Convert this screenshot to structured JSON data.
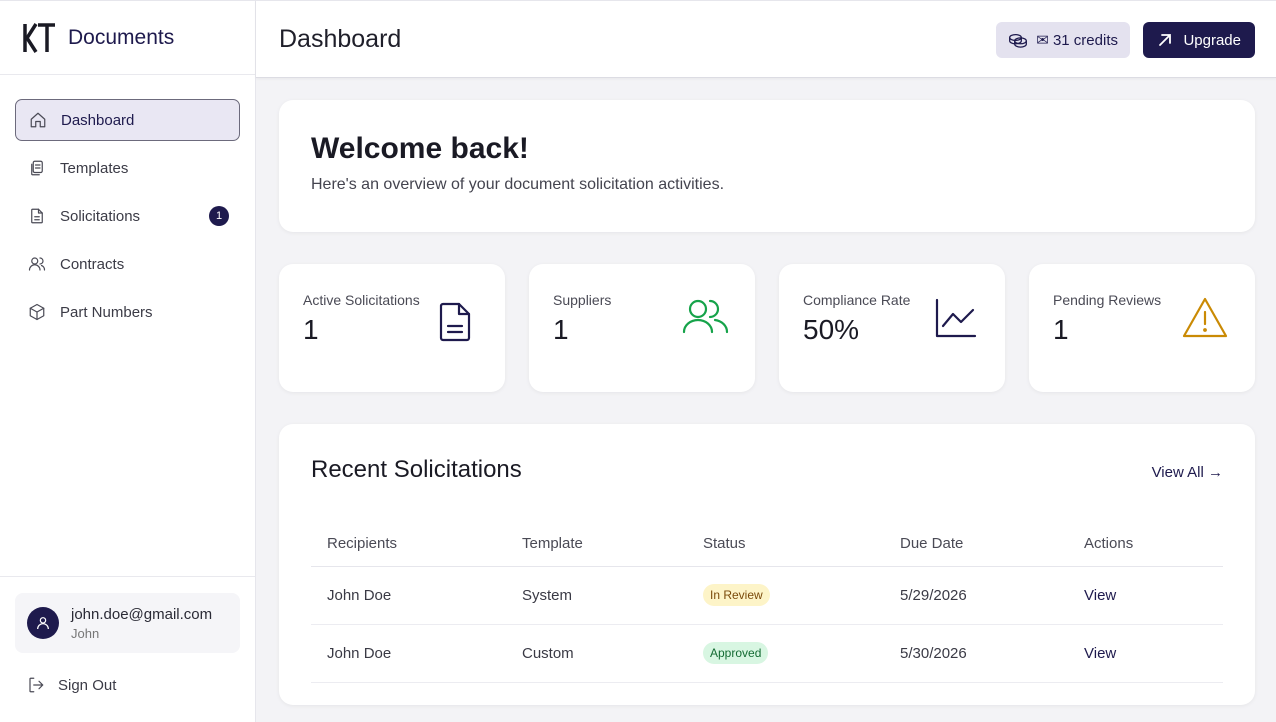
{
  "app": {
    "name": "Documents"
  },
  "sidebar": {
    "items": [
      {
        "label": "Dashboard",
        "icon": "home-icon",
        "active": true
      },
      {
        "label": "Templates",
        "icon": "copy-document-icon"
      },
      {
        "label": "Solicitations",
        "icon": "file-text-icon",
        "badge": "1"
      },
      {
        "label": "Contracts",
        "icon": "users-icon"
      },
      {
        "label": "Part Numbers",
        "icon": "box-icon"
      }
    ],
    "user": {
      "email": "john.doe@gmail.com",
      "name": "John"
    },
    "signout_label": "Sign Out"
  },
  "header": {
    "title": "Dashboard",
    "credits_label": "✉ 31 credits",
    "upgrade_label": "Upgrade"
  },
  "welcome": {
    "title": "Welcome back!",
    "subtitle": "Here's an overview of your document solicitation activities."
  },
  "stats": [
    {
      "label": "Active Solicitations",
      "value": "1",
      "icon": "file-text-icon",
      "color": "#1e1a4d"
    },
    {
      "label": "Suppliers",
      "value": "1",
      "icon": "users-icon",
      "color": "#16a34a"
    },
    {
      "label": "Compliance Rate",
      "value": "50%",
      "icon": "line-chart-icon",
      "color": "#1e1a4d"
    },
    {
      "label": "Pending Reviews",
      "value": "1",
      "icon": "warning-icon",
      "color": "#ca8a04"
    }
  ],
  "recent": {
    "title": "Recent Solicitations",
    "view_all_label": "View All →",
    "columns": [
      "Recipients",
      "Template",
      "Status",
      "Due Date",
      "Actions"
    ],
    "rows": [
      {
        "recipient": "John Doe",
        "template": "System",
        "status": "In Review",
        "due": "5/29/2026",
        "action": "View"
      },
      {
        "recipient": "John Doe",
        "template": "Custom",
        "status": "Approved",
        "due": "5/30/2026",
        "action": "View"
      }
    ]
  },
  "colors": {
    "brand": "#1e1a4d",
    "success": "#16a34a",
    "warning": "#ca8a04"
  }
}
